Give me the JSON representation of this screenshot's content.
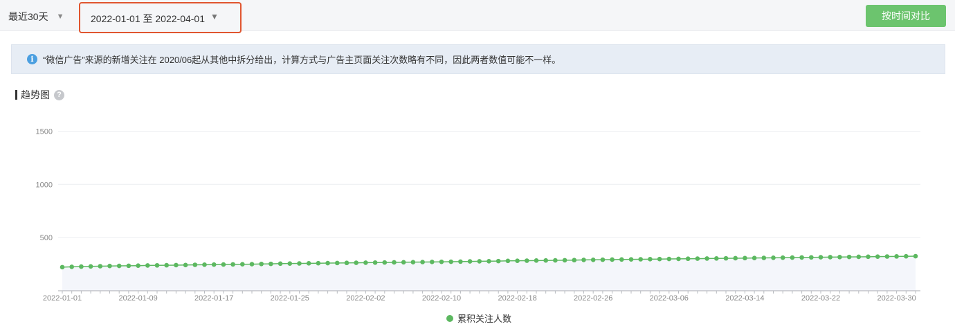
{
  "toolbar": {
    "range_label": "最近30天",
    "date_range": "2022-01-01 至 2022-04-01",
    "compare_label": "按时间对比"
  },
  "notice": {
    "icon": "info-icon",
    "text": "“微信广告”来源的新增关注在 2020/06起从其他中拆分给出，计算方式与广告主页面关注次数略有不同，因此两者数值可能不一样。"
  },
  "section": {
    "title": "趋势图",
    "help_icon": "question-icon"
  },
  "colors": {
    "accent": "#6cc46e",
    "line": "#5cb860",
    "highlight_border": "#e0552f"
  },
  "chart_data": {
    "type": "line",
    "y_ticks": [
      "1500",
      "1000",
      "500"
    ],
    "x_tick_labels": [
      "2022-01-01",
      "2022-01-09",
      "2022-01-17",
      "2022-01-25",
      "2022-02-02",
      "2022-02-10",
      "2022-02-18",
      "2022-02-26",
      "2022-03-06",
      "2022-03-14",
      "2022-03-22",
      "2022-03-30"
    ],
    "ylim": [
      0,
      1650
    ],
    "start_date": "2022-01-01",
    "series": [
      {
        "name": "累积关注人数",
        "values": [
          222,
          225,
          227,
          229,
          231,
          233,
          234,
          235,
          236,
          238,
          239,
          240,
          241,
          242,
          244,
          245,
          246,
          247,
          248,
          249,
          250,
          252,
          253,
          255,
          256,
          257,
          258,
          259,
          260,
          261,
          262,
          263,
          264,
          265,
          266,
          267,
          268,
          269,
          270,
          271,
          272,
          273,
          274,
          276,
          277,
          278,
          279,
          281,
          282,
          283,
          284,
          285,
          286,
          287,
          288,
          290,
          291,
          292,
          293,
          294,
          295,
          296,
          297,
          298,
          299,
          300,
          301,
          302,
          303,
          304,
          305,
          306,
          307,
          308,
          309,
          310,
          311,
          312,
          313,
          314,
          315,
          316,
          317,
          318,
          319,
          320,
          321,
          322,
          323,
          324,
          325
        ]
      }
    ],
    "legend_position": "bottom-center"
  }
}
